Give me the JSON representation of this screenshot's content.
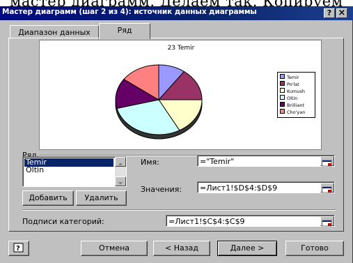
{
  "background_text": "мастер диаграмм. Делаем так. Копируем",
  "window": {
    "title": "Мастер диаграмм (шаг 2 из 4): источник данных диаграммы",
    "help_btn": "?",
    "close_btn": "×"
  },
  "tabs": [
    {
      "label": "Диапазон данных",
      "active": false
    },
    {
      "label": "Ряд",
      "active": true
    }
  ],
  "chart_data": {
    "type": "pie",
    "title": "23 Temir",
    "categories": [
      "Temir",
      "Po'lat",
      "Kumush",
      "Oltin",
      "Brilliant",
      "Cho'yan"
    ],
    "values": [
      10,
      15,
      17,
      29,
      14,
      15
    ],
    "colors": [
      "#9999ff",
      "#993366",
      "#ffffcc",
      "#ccffff",
      "#660066",
      "#ff8080"
    ],
    "legend": [
      "Temir",
      "Po'lat",
      "Kumush",
      "Oltin",
      "Brilliant",
      "Cho'yan"
    ],
    "legend_position": "right"
  },
  "series_section": {
    "label": "Ряд",
    "items": [
      "Temir",
      "Oltin"
    ],
    "selected": "Temir",
    "add_btn": "Добавить",
    "remove_btn": "Удалить"
  },
  "fields": {
    "name_label": "Имя:",
    "name_value": "=\"Temir\"",
    "values_label": "Значения:",
    "values_value": "=Лист1!$D$4:$D$9",
    "category_label": "Подписи категорий:",
    "category_value": "=Лист1!$C$4:$C$9"
  },
  "buttons": {
    "help": "?",
    "cancel": "Отмена",
    "back": "< Назад",
    "next": "Далее >",
    "finish": "Готово"
  }
}
